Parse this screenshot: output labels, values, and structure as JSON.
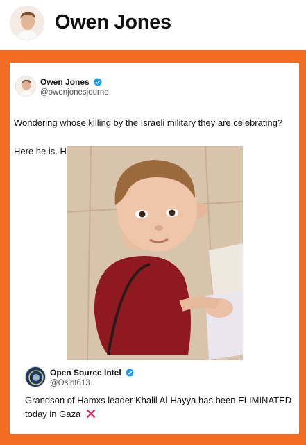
{
  "header": {
    "name": "Owen Jones"
  },
  "tweet": {
    "author_name": "Owen Jones",
    "author_handle": "@owenjonesjourno",
    "text_line1": "Wondering whose killing by the Israeli military they are celebrating?",
    "text_line2": "Here he is. He was two years old"
  },
  "quoted": {
    "author_name": "Open Source Intel",
    "author_handle": "@Osint613",
    "text": "Grandson of Hamxs leader Khalil Al-Hayya has been ELIMINATED today in Gaza"
  },
  "colors": {
    "frame": "#f26d22",
    "verified": "#1d9bf0",
    "cross": "#e0245e"
  },
  "icons": {
    "verified": "verified-badge-icon",
    "cross": "cross-mark-icon"
  }
}
